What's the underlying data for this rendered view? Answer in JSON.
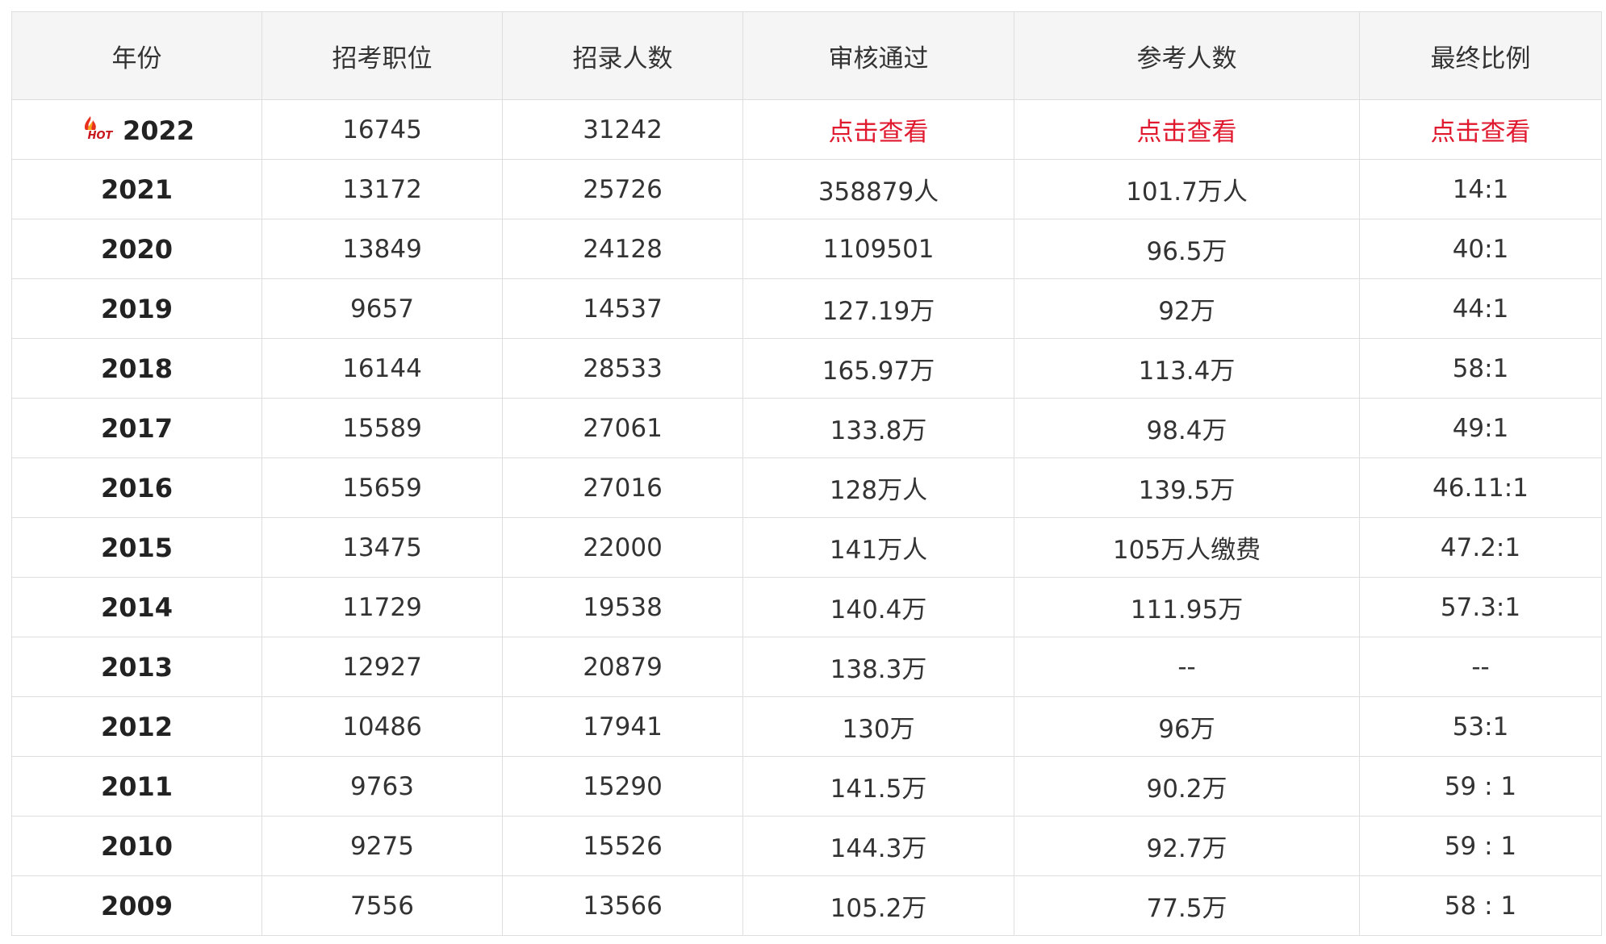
{
  "table": {
    "headers": [
      "年份",
      "招考职位",
      "招录人数",
      "审核通过",
      "参考人数",
      "最终比例"
    ],
    "hot_icon": "hot-flame-icon",
    "link_color": "#e0192e",
    "rows": [
      [
        "2022",
        "16745",
        "31242",
        "点击查看",
        "点击查看",
        "点击查看"
      ],
      [
        "2021",
        "13172",
        "25726",
        "358879人",
        "101.7万人",
        "14:1"
      ],
      [
        "2020",
        "13849",
        "24128",
        "1109501",
        "96.5万",
        "40:1"
      ],
      [
        "2019",
        "9657",
        "14537",
        "127.19万",
        "92万",
        "44:1"
      ],
      [
        "2018",
        "16144",
        "28533",
        "165.97万",
        "113.4万",
        "58:1"
      ],
      [
        "2017",
        "15589",
        "27061",
        "133.8万",
        "98.4万",
        "49:1"
      ],
      [
        "2016",
        "15659",
        "27016",
        "128万人",
        "139.5万",
        "46.11:1"
      ],
      [
        "2015",
        "13475",
        "22000",
        "141万人",
        "105万人缴费",
        "47.2:1"
      ],
      [
        "2014",
        "11729",
        "19538",
        "140.4万",
        "111.95万",
        "57.3:1"
      ],
      [
        "2013",
        "12927",
        "20879",
        "138.3万",
        "--",
        "--"
      ],
      [
        "2012",
        "10486",
        "17941",
        "130万",
        "96万",
        "53:1"
      ],
      [
        "2011",
        "9763",
        "15290",
        "141.5万",
        "90.2万",
        "59 : 1"
      ],
      [
        "2010",
        "9275",
        "15526",
        "144.3万",
        "92.7万",
        "59 : 1"
      ],
      [
        "2009",
        "7556",
        "13566",
        "105.2万",
        "77.5万",
        "58 : 1"
      ]
    ]
  }
}
